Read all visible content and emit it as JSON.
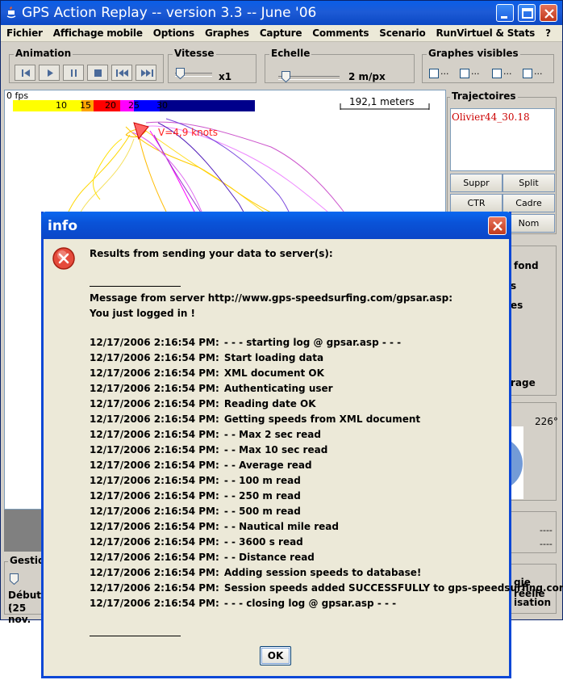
{
  "window": {
    "title": "GPS Action Replay -- version 3.3 -- June '06"
  },
  "menu": [
    "Fichier",
    "Affichage mobile",
    "Options",
    "Graphes",
    "Capture",
    "Comments",
    "Scenario",
    "RunVirtuel & Stats",
    "?"
  ],
  "toolbar": {
    "animation_label": "Animation",
    "vitesse_label": "Vitesse",
    "vitesse_value": "x1",
    "echelle_label": "Echelle",
    "echelle_value": "2 m/px",
    "graphes_label": "Graphes visibles",
    "graphes_checks": [
      "...",
      "...",
      "...",
      "..."
    ]
  },
  "map": {
    "fps": "0 fps",
    "colorbar_ticks": [
      "10",
      "15",
      "20",
      "25",
      "30"
    ],
    "colorbar_colors": [
      "#ffff00",
      "#ffa500",
      "#ff0000",
      "#ff00ff",
      "#0000ff",
      "#00008b"
    ],
    "scale_label": "192,1 meters",
    "speed_label": "V=4,9 knots"
  },
  "right_panel": {
    "trajectoires_label": "Trajectoires",
    "trajectory_item": "Olivier44_30.18",
    "buttons": [
      "Suppr",
      "Split",
      "CTR",
      "Cadre",
      "Nom"
    ],
    "partial_fond": "fond",
    "partial_s": "s",
    "partial_es": "es",
    "partial_rage": "rage",
    "angle": "226°",
    "dashes1": "----",
    "dashes2": "----",
    "partial_gie": "gie réelle",
    "partial_isation": "isation"
  },
  "bottom_panel": {
    "gestion_label": "Gestion",
    "debut_label": "Début :",
    "debut_value": "(25 nov."
  },
  "dialog": {
    "title": "info",
    "header": "Results from sending your data to server(s):",
    "server_message": "Message from server http://www.gps-speedsurfing.com/gpsar.asp:",
    "logged_in": "You just logged in !",
    "ok_label": "OK",
    "log": [
      {
        "ts": "12/17/2006 2:16:54 PM:",
        "msg": "- - - starting log @ gpsar.asp - - -"
      },
      {
        "ts": "12/17/2006 2:16:54 PM:",
        "msg": "Start loading data"
      },
      {
        "ts": "12/17/2006 2:16:54 PM:",
        "msg": "XML document OK"
      },
      {
        "ts": "12/17/2006 2:16:54 PM:",
        "msg": "Authenticating user"
      },
      {
        "ts": "12/17/2006 2:16:54 PM:",
        "msg": "Reading date OK"
      },
      {
        "ts": "12/17/2006 2:16:54 PM:",
        "msg": "Getting speeds from XML document"
      },
      {
        "ts": "12/17/2006 2:16:54 PM:",
        "msg": "- - Max 2 sec read"
      },
      {
        "ts": "12/17/2006 2:16:54 PM:",
        "msg": "- - Max 10 sec read"
      },
      {
        "ts": "12/17/2006 2:16:54 PM:",
        "msg": "- - Average read"
      },
      {
        "ts": "12/17/2006 2:16:54 PM:",
        "msg": "- - 100 m read"
      },
      {
        "ts": "12/17/2006 2:16:54 PM:",
        "msg": "- - 250 m read"
      },
      {
        "ts": "12/17/2006 2:16:54 PM:",
        "msg": "- - 500 m read"
      },
      {
        "ts": "12/17/2006 2:16:54 PM:",
        "msg": "- - Nautical mile read"
      },
      {
        "ts": "12/17/2006 2:16:54 PM:",
        "msg": "- - 3600 s read"
      },
      {
        "ts": "12/17/2006 2:16:54 PM:",
        "msg": "- - Distance read"
      },
      {
        "ts": "12/17/2006 2:16:54 PM:",
        "msg": "Adding session speeds to database!"
      },
      {
        "ts": "12/17/2006 2:16:54 PM:",
        "msg": "Session speeds added SUCCESSFULLY to gps-speedsurfing.com!!"
      },
      {
        "ts": "12/17/2006 2:16:54 PM:",
        "msg": "- - - closing log @ gpsar.asp - - -"
      }
    ]
  }
}
